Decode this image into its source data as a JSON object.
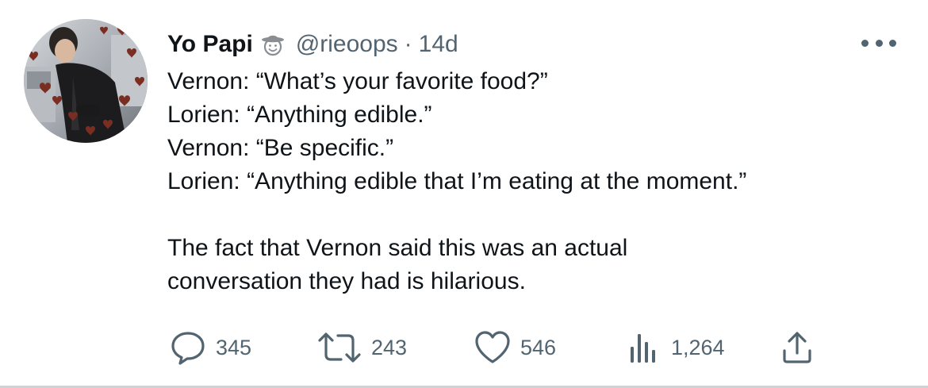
{
  "tweet": {
    "author": {
      "display_name": "Yo Papi",
      "emoji_icon": "cowboy-hat-face-emoji",
      "handle": "@rieoops",
      "separator": "·",
      "timestamp": "14d"
    },
    "text_lines": [
      "Vernon: “What’s your favorite food?”",
      "Lorien: “Anything edible.”",
      "Vernon: “Be specific.”",
      "Lorien: “Anything edible that I’m eating at the moment.”",
      "",
      "The fact that Vernon said this was an actual",
      "conversation they had is hilarious."
    ],
    "actions": {
      "reply": {
        "icon": "reply-icon",
        "count": "345"
      },
      "retweet": {
        "icon": "retweet-icon",
        "count": "243"
      },
      "like": {
        "icon": "heart-icon",
        "count": "546"
      },
      "views": {
        "icon": "views-icon",
        "count": "1,264"
      },
      "share": {
        "icon": "share-icon"
      }
    },
    "more_icon": "more-options-icon"
  },
  "colors": {
    "text_primary": "#0f1419",
    "text_secondary": "#536471",
    "heart_accent": "#7a2e22",
    "divider": "#cfd3d6"
  }
}
